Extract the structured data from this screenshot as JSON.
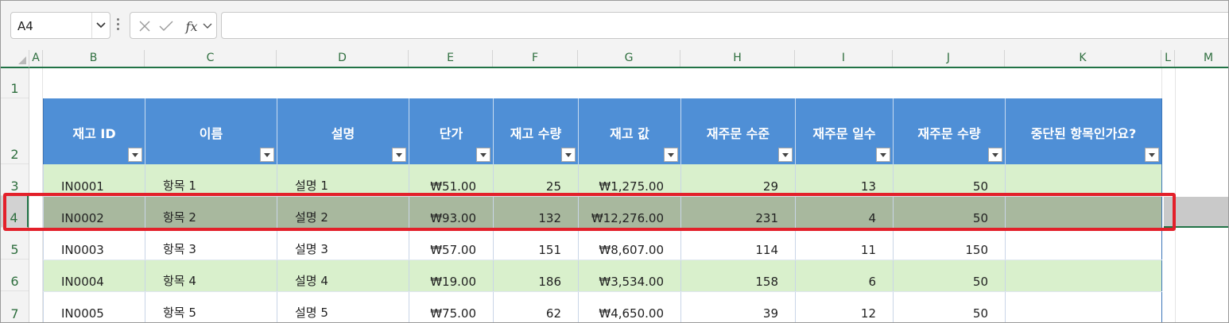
{
  "formula_bar": {
    "name_box": "A4",
    "formula": ""
  },
  "icons": {
    "cancel": "close-icon",
    "enter": "check-icon",
    "function": "fx-icon",
    "dropdown": "chevron-down-icon"
  },
  "fx_label": "fx",
  "columns": [
    "A",
    "B",
    "C",
    "D",
    "E",
    "F",
    "G",
    "H",
    "I",
    "J",
    "K",
    "L",
    "M"
  ],
  "rows": [
    "1",
    "2",
    "3",
    "4",
    "5",
    "6",
    "7"
  ],
  "selected_row": "4",
  "colors": {
    "header_fill": "#4f8fd6",
    "band_fill": "#d9f0cc",
    "selected_row_fill": "#a8b89e",
    "highlight_border": "#e3202a",
    "excel_green": "#217346"
  },
  "table": {
    "headers": [
      "재고 ID",
      "이름",
      "설명",
      "단가",
      "재고 수량",
      "재고 값",
      "재주문 수준",
      "재주문 일수",
      "재주문 수량",
      "중단된 항목인가요?"
    ],
    "rows": [
      [
        "IN0001",
        "항목 1",
        "설명 1",
        "₩51.00",
        "25",
        "₩1,275.00",
        "29",
        "13",
        "50",
        ""
      ],
      [
        "IN0002",
        "항목 2",
        "설명 2",
        "₩93.00",
        "132",
        "₩12,276.00",
        "231",
        "4",
        "50",
        ""
      ],
      [
        "IN0003",
        "항목 3",
        "설명 3",
        "₩57.00",
        "151",
        "₩8,607.00",
        "114",
        "11",
        "150",
        ""
      ],
      [
        "IN0004",
        "항목 4",
        "설명 4",
        "₩19.00",
        "186",
        "₩3,534.00",
        "158",
        "6",
        "50",
        ""
      ],
      [
        "IN0005",
        "항목 5",
        "설명 5",
        "₩75.00",
        "62",
        "₩4,650.00",
        "39",
        "12",
        "50",
        ""
      ]
    ]
  }
}
